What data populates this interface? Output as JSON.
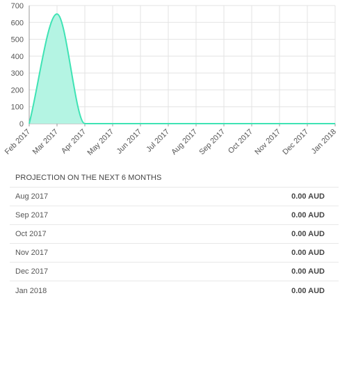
{
  "chart_data": {
    "type": "area",
    "x": [
      "Feb 2017",
      "Mar 2017",
      "Apr 2017",
      "May 2017",
      "Jun 2017",
      "Jul 2017",
      "Aug 2017",
      "Sep 2017",
      "Oct 2017",
      "Nov 2017",
      "Dec 2017",
      "Jan 2018"
    ],
    "values": [
      0,
      650,
      0,
      0,
      0,
      0,
      0,
      0,
      0,
      0,
      0,
      0
    ],
    "ylim": [
      0,
      700
    ],
    "yticks": [
      0,
      100,
      200,
      300,
      400,
      500,
      600,
      700
    ],
    "grid": true,
    "line_color": "#3ee3b4",
    "fill_color": "#b4f4e3"
  },
  "projection": {
    "title": "PROJECTION ON THE NEXT 6 MONTHS",
    "rows": [
      {
        "month": "Aug 2017",
        "amount": "0.00 AUD"
      },
      {
        "month": "Sep 2017",
        "amount": "0.00 AUD"
      },
      {
        "month": "Oct 2017",
        "amount": "0.00 AUD"
      },
      {
        "month": "Nov 2017",
        "amount": "0.00 AUD"
      },
      {
        "month": "Dec 2017",
        "amount": "0.00 AUD"
      },
      {
        "month": "Jan 2018",
        "amount": "0.00 AUD"
      }
    ]
  }
}
